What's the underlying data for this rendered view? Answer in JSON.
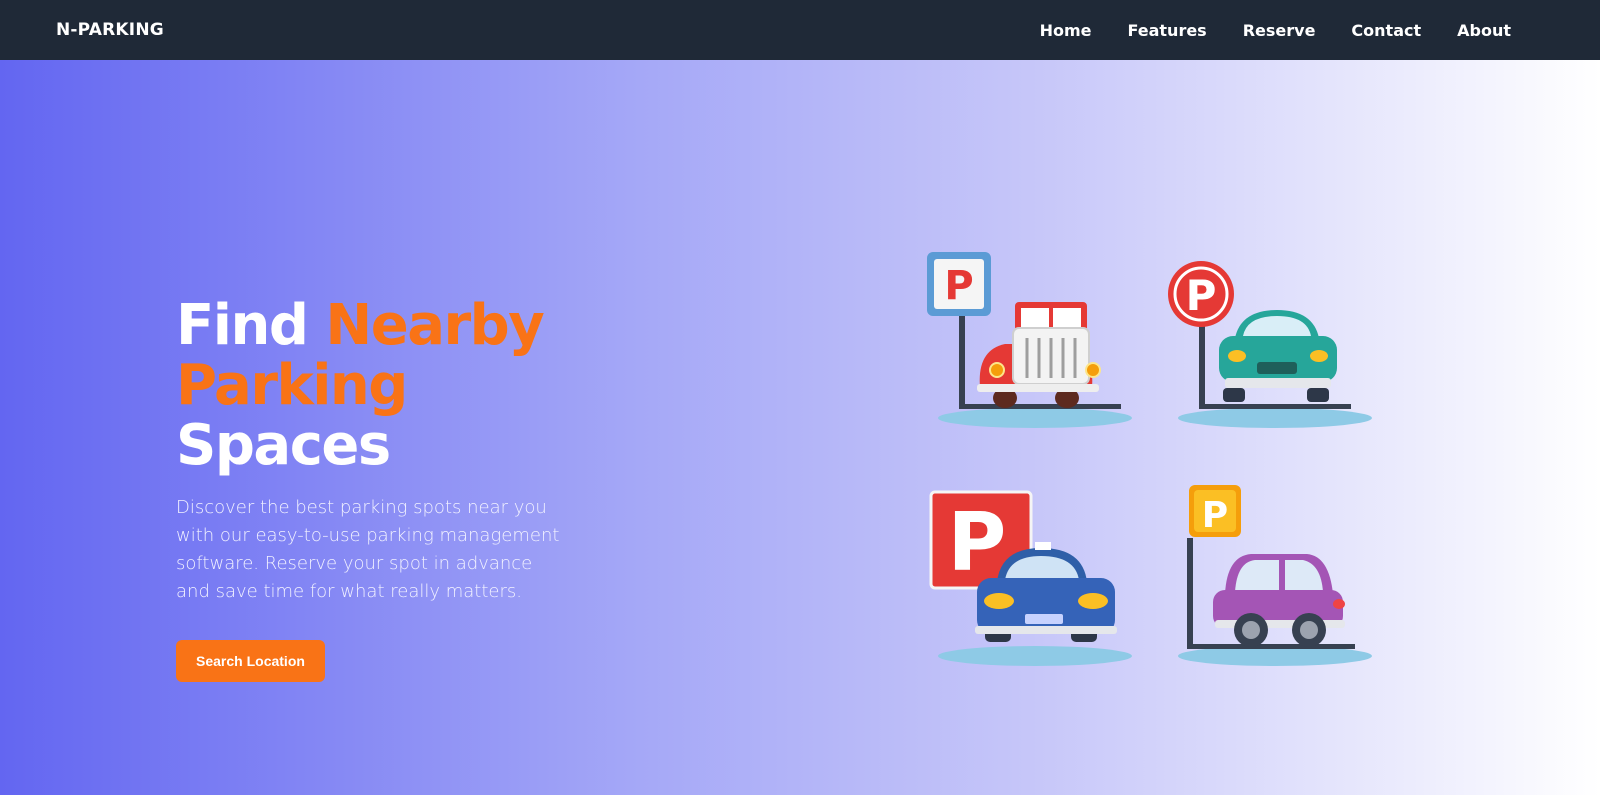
{
  "nav": {
    "brand": "N-PARKING",
    "links": [
      "Home",
      "Features",
      "Reserve",
      "Contact",
      "About"
    ]
  },
  "hero": {
    "headline_w1": "Find ",
    "headline_w2": "Nearby",
    "headline_w3": "Parking",
    "headline_w4": " Spaces",
    "description": "Discover the best parking spots near you with our easy-to-use parking management software. Reserve your spot in advance and save time for what really matters.",
    "cta_label": "Search Location"
  },
  "colors": {
    "nav_bg": "#1f2937",
    "accent": "#f97316",
    "gradient_start": "#6366f1",
    "gradient_end": "#ffffff"
  },
  "illustration": {
    "icons": [
      "parking-sign-icon",
      "car-icon"
    ]
  }
}
